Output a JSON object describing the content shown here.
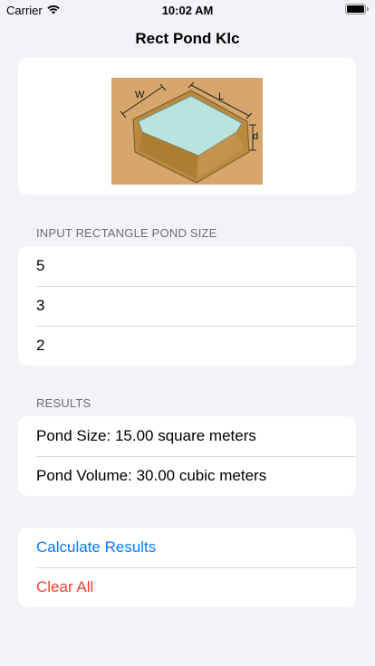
{
  "status_bar": {
    "carrier": "Carrier",
    "time": "10:02 AM"
  },
  "nav": {
    "title": "Rect Pond Klc"
  },
  "figure": {
    "label_w": "W",
    "label_l": "L",
    "label_d": "d"
  },
  "inputs": {
    "header": "INPUT RECTANGLE POND SIZE",
    "length": "5",
    "width": "3",
    "depth": "2"
  },
  "results": {
    "header": "RESULTS",
    "pond_size": "Pond Size: 15.00 square meters",
    "pond_volume": "Pond Volume: 30.00 cubic meters"
  },
  "actions": {
    "calculate": "Calculate Results",
    "clear": "Clear All"
  },
  "colors": {
    "accent": "#0a7aff",
    "destructive": "#ff3b30",
    "background": "#f2f2f7"
  }
}
